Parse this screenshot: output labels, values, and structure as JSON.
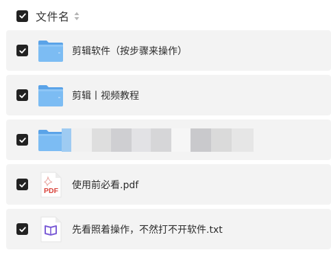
{
  "header": {
    "label": "文件名",
    "select_all_checked": true
  },
  "files": [
    {
      "name": "剪辑软件（按步骤来操作）",
      "type": "folder",
      "checked": true,
      "icon": "folder-icon"
    },
    {
      "name": "剪辑丨视频教程",
      "type": "folder",
      "checked": true,
      "icon": "folder-icon"
    },
    {
      "name": "",
      "type": "folder",
      "checked": true,
      "icon": "folder-icon",
      "name_obscured": true
    },
    {
      "name": "使用前必看.pdf",
      "type": "pdf",
      "checked": true,
      "icon": "pdf-file-icon",
      "icon_text": "PDF"
    },
    {
      "name": "先看照着操作，不然打不开软件.txt",
      "type": "txt",
      "checked": true,
      "icon": "book-file-icon"
    }
  ],
  "colors": {
    "checkbox": "#222222",
    "row_background": "#f3f3f3",
    "folder": "#6fb3ef",
    "pdf_accent": "#d9423a",
    "txt_accent": "#7b5cd6"
  }
}
